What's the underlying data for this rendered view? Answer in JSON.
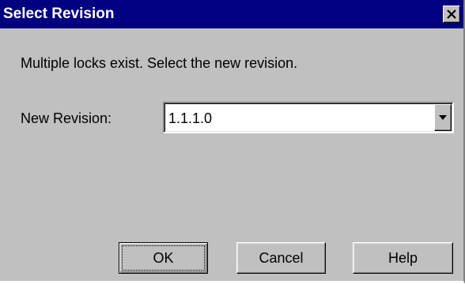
{
  "window": {
    "title": "Select Revision"
  },
  "message": "Multiple locks exist.  Select the new revision.",
  "revision": {
    "label": "New Revision:",
    "value": "1.1.1.0"
  },
  "buttons": {
    "ok": "OK",
    "cancel": "Cancel",
    "help": "Help"
  },
  "icons": {
    "close": "close-icon",
    "dropdown": "chevron-down-icon"
  },
  "colors": {
    "titlebar": "#000080",
    "dialog_face": "#c0c0c0",
    "title_text": "#ffffff"
  }
}
